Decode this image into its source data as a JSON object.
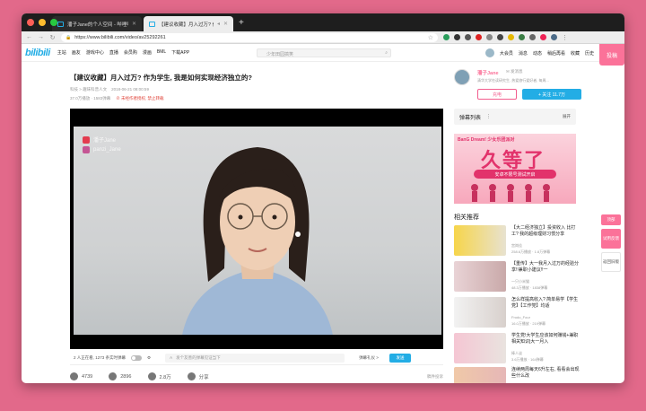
{
  "browser": {
    "tabs": [
      {
        "title": "潘子Jane的个人空间 - 哔哩哔哩 ( ゜- ゜)つロ 乾杯~ Bilibili"
      },
      {
        "title": "【建议收藏】月入过万? 作为学生, 我是如何实现经济独立的? _哔哩哔哩"
      }
    ],
    "url": "https://www.bilibili.com/video/av25292261",
    "new_tab": "+"
  },
  "site": {
    "logo": "bilibili",
    "nav": [
      "主站",
      "画友",
      "游戏中心",
      "直播",
      "会员购",
      "漫画",
      "BML",
      "下载APP"
    ],
    "search_placeholder": "少年田园搞笑",
    "right_nav": [
      "大会员",
      "消息",
      "动态",
      "稍后再看",
      "收藏",
      "历史"
    ],
    "upload": "投稿"
  },
  "video": {
    "title": "【建议收藏】月入过万? 作为学生, 我是如何实现经济独立的?",
    "category": "科技 > 趣味科普人文",
    "date": "2018-06-21 08:00:59",
    "views": "37.0万播放 · 1583弹幕",
    "warning": "未经作者授权, 禁止转载",
    "watermark_weibo": "潘子Jane",
    "watermark_ins": "panzi_Jane"
  },
  "controls": {
    "watching": "2 人正在看, 1273 条实时弹幕",
    "danmu_placeholder": "发个友善的弹幕见证当下",
    "etiquette": "弹幕礼仪 >",
    "send": "发送"
  },
  "actions": {
    "like": "4739",
    "coin": "2896",
    "fav": "2.8万",
    "share": "分享",
    "report": "稿件投诉"
  },
  "uploader": {
    "name": "潘子Jane",
    "message": "发消息",
    "desc": "清华大学在读研究生, 热爱旅行爱好者, 每周...",
    "charge": "充电",
    "follow": "+ 关注 11.7万"
  },
  "danmu_panel": {
    "title": "弹幕列表",
    "expand": "展开"
  },
  "ad": {
    "brand": "BanG Dream! 少女乐团派对",
    "headline": "久等了",
    "sub": "安卓不限号测试开启"
  },
  "recs": {
    "title": "相关推荐",
    "items": [
      {
        "title": "【大二经济独立】投资收入 比打工? 我的超级理财习惯分享",
        "up": "宫岗佳",
        "stats": "258.6万播放 · 1.8万弹幕"
      },
      {
        "title": "【重传】大一我月入过万的经验分享!!兼职小建议!!一",
        "up": "一只小米猫",
        "stats": "48.3万播放 · 1838弹幕"
      },
      {
        "title": "怎么样提高收入? 简单易学【学生党】【工作党】均适",
        "up": "Frodo_Four",
        "stats": "16.0万播放 · 219弹幕"
      },
      {
        "title": "学生党!大学生应该如何赚钱+兼职相关知识|大一月入",
        "up": "棒人谈",
        "stats": "3.6万播放 · 164弹幕"
      },
      {
        "title": "连续两周每天6升左右, 看看会出现些什么改",
        "up": "",
        "stats": ""
      }
    ]
  },
  "side_float": {
    "top": "顶部",
    "feedback": "试用反馈",
    "back": "返回旧版"
  }
}
